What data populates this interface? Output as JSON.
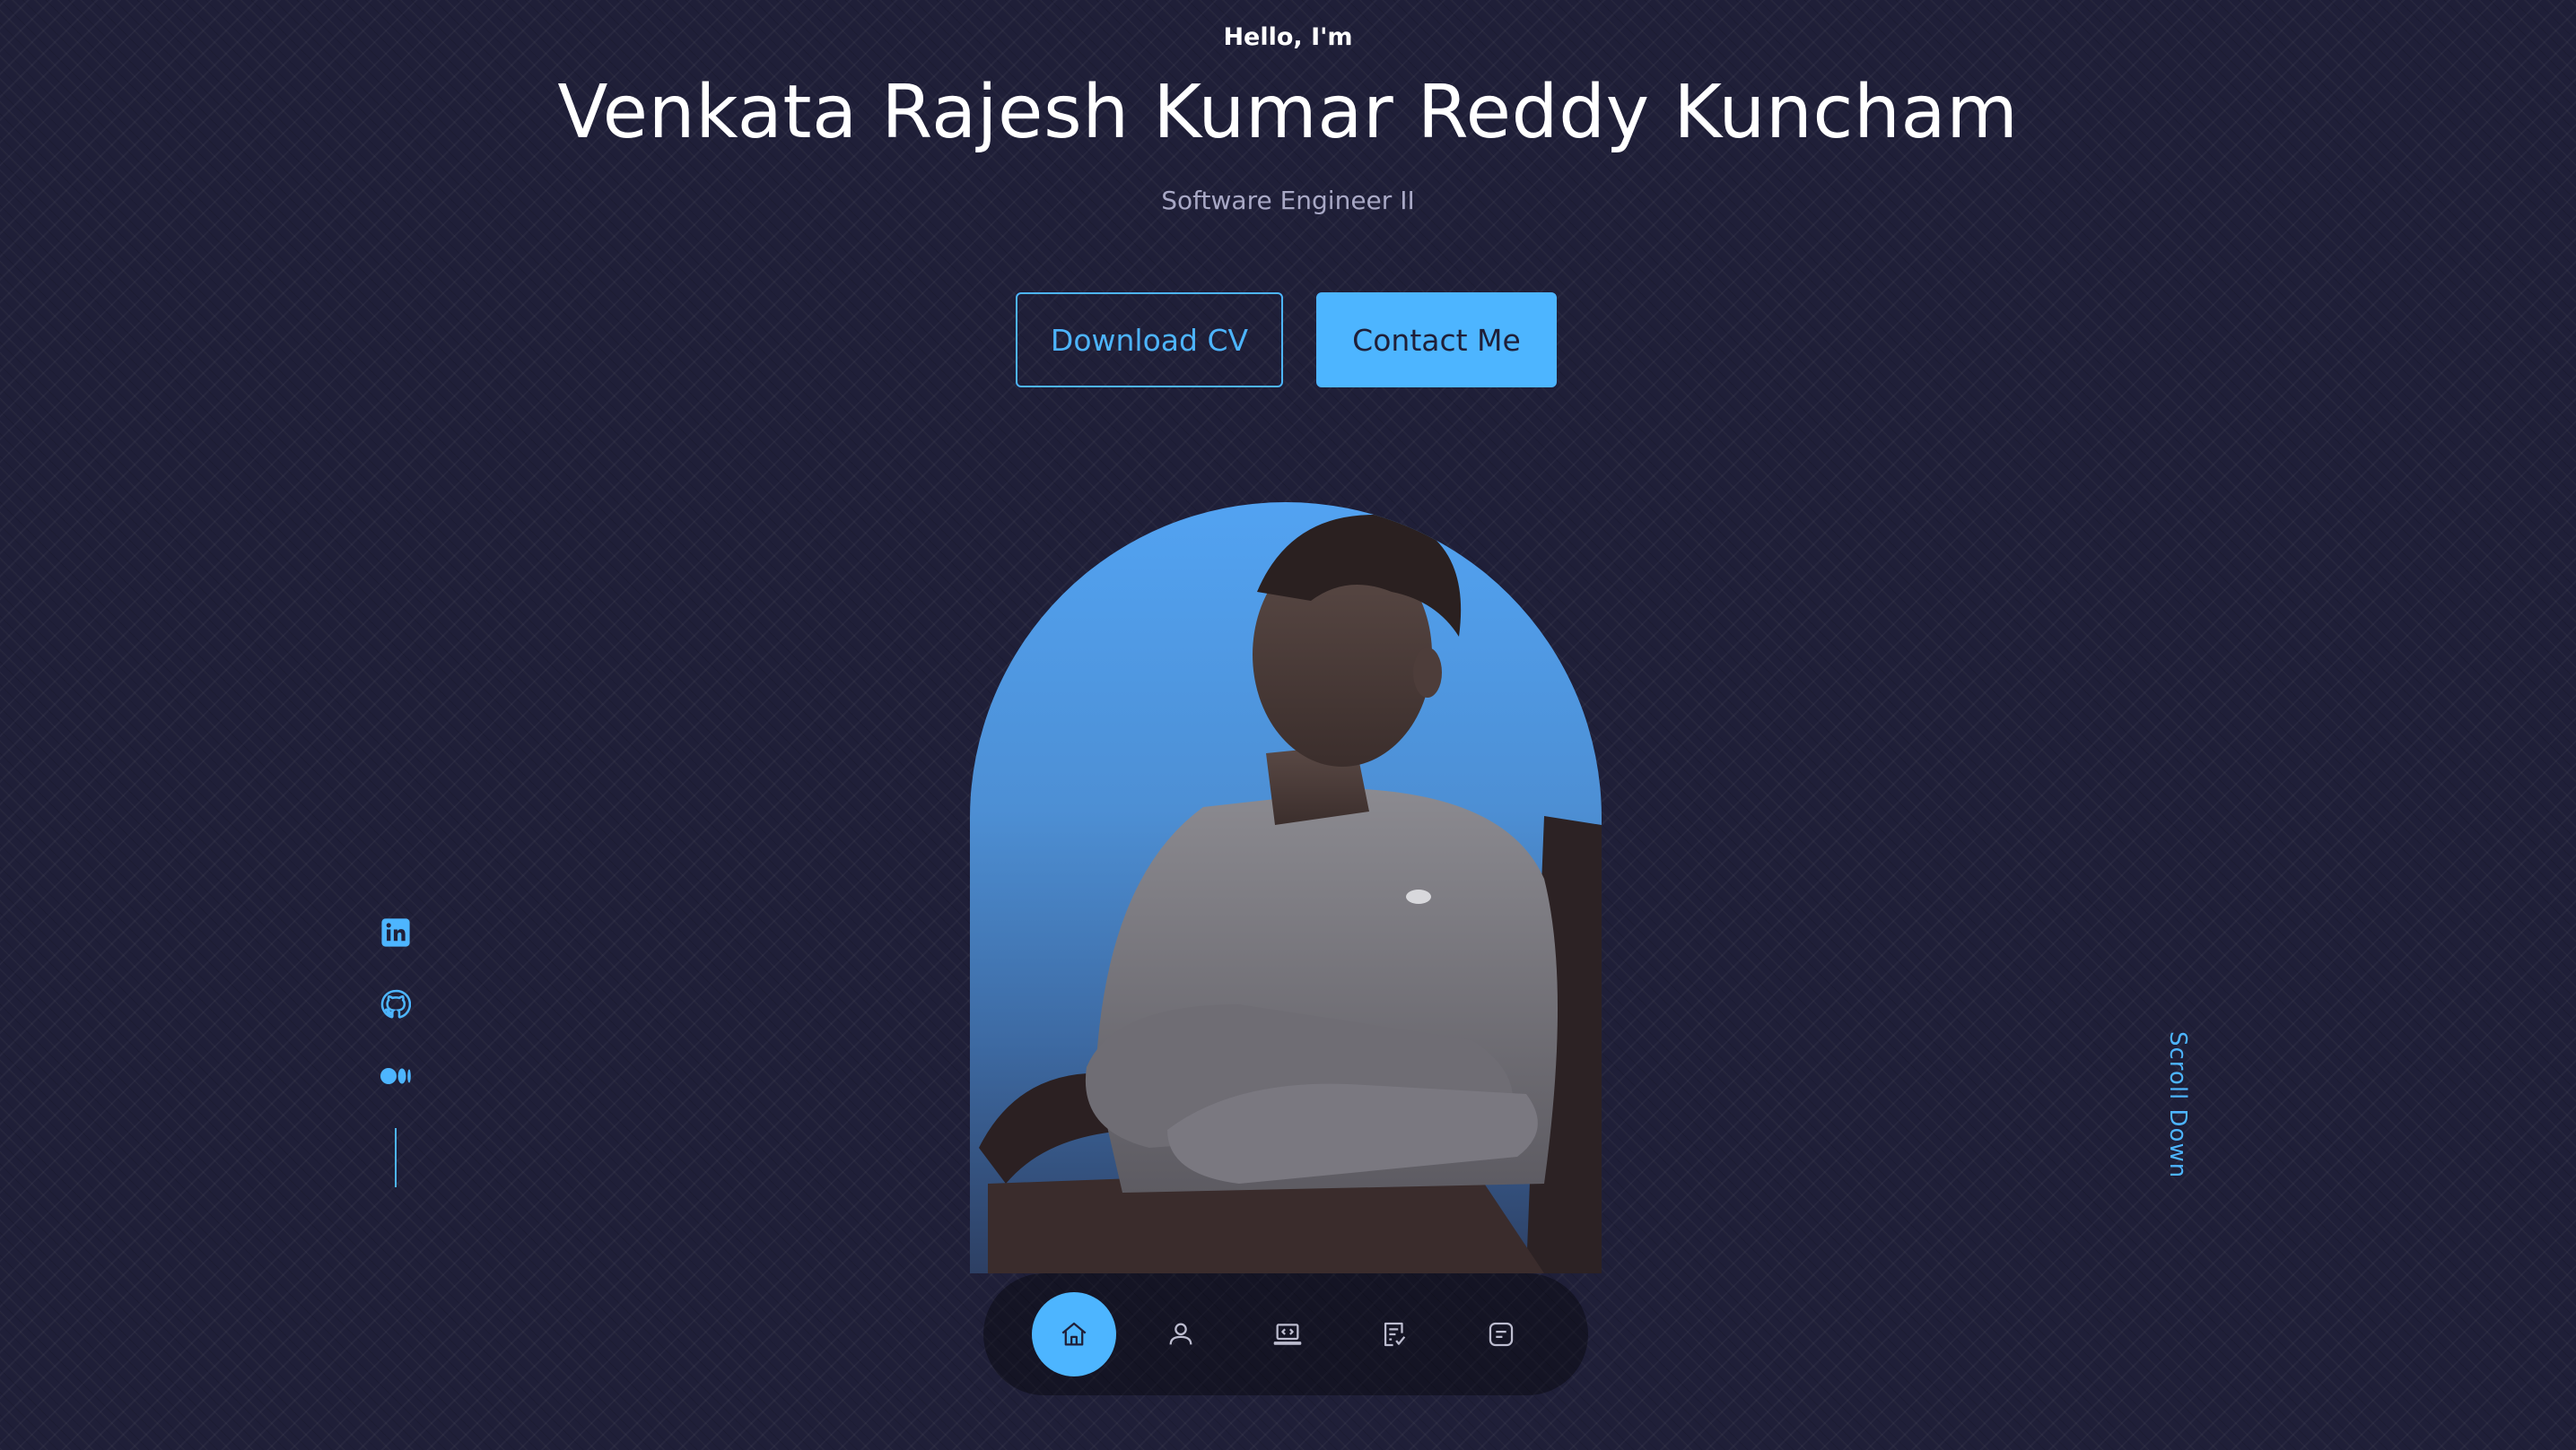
{
  "header": {
    "greeting": "Hello, I'm",
    "name": "Venkata Rajesh Kumar Reddy Kuncham",
    "role": "Software Engineer II"
  },
  "cta": {
    "download_label": "Download CV",
    "contact_label": "Contact Me"
  },
  "socials": [
    {
      "icon": "linkedin-icon"
    },
    {
      "icon": "github-icon"
    },
    {
      "icon": "medium-icon"
    }
  ],
  "scroll_down_label": "Scroll Down",
  "nav": {
    "items": [
      {
        "icon": "home-icon",
        "active": true
      },
      {
        "icon": "user-icon",
        "active": false
      },
      {
        "icon": "laptop-code-icon",
        "active": false
      },
      {
        "icon": "checklist-icon",
        "active": false
      },
      {
        "icon": "message-icon",
        "active": false
      }
    ]
  },
  "colors": {
    "background": "#1f1f38",
    "accent": "#4db5ff",
    "muted_text": "#a9a9c6"
  }
}
